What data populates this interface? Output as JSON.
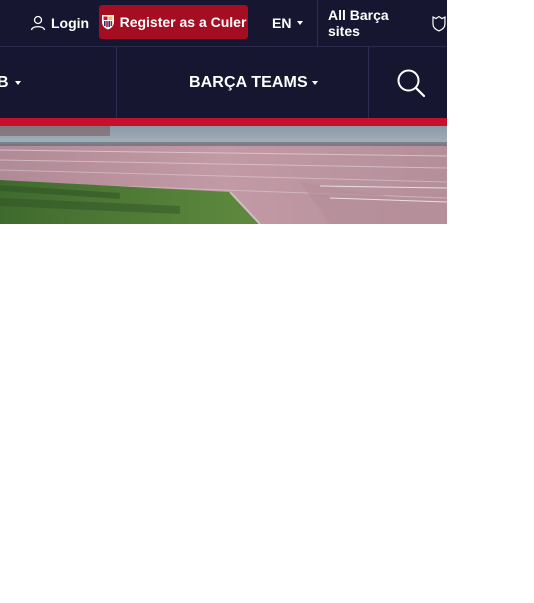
{
  "topbar": {
    "login_label": "Login",
    "register_label": "Register as a Culer",
    "language": "EN",
    "all_sites_label": "All Barça sites"
  },
  "nav": {
    "left_item_fragment": "B",
    "teams_label": "BARÇA TEAMS"
  },
  "colors": {
    "navy": "#161631",
    "red_accent": "#c8102e",
    "register_bg": "#a50e22"
  },
  "icons": [
    "user-icon",
    "barca-crest-icon",
    "chevron-down-icon",
    "shield-icon",
    "search-icon"
  ]
}
